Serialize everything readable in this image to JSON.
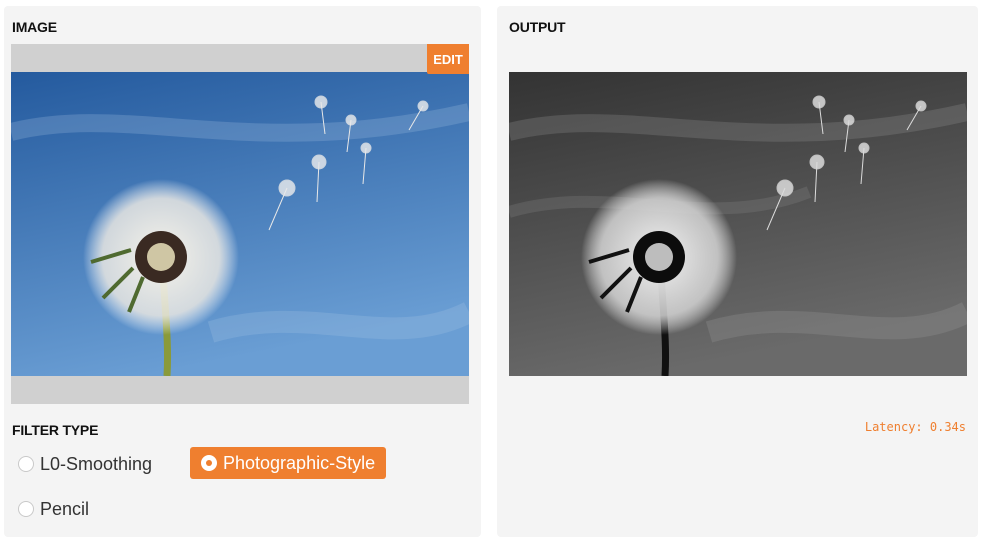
{
  "input": {
    "title": "IMAGE",
    "edit_label": "EDIT"
  },
  "filter": {
    "title": "FILTER TYPE",
    "options": [
      {
        "label": "L0-Smoothing",
        "selected": false
      },
      {
        "label": "Photographic-Style",
        "selected": true
      },
      {
        "label": "Pencil",
        "selected": false
      }
    ]
  },
  "output": {
    "title": "OUTPUT",
    "latency": "Latency: 0.34s"
  },
  "colors": {
    "accent": "#ef7f2f",
    "panel_bg": "#f4f4f4",
    "sky_top": "#2d64a8",
    "sky_bottom": "#5f95cf"
  },
  "icons": [
    "radio-icon",
    "dandelion-photo"
  ]
}
